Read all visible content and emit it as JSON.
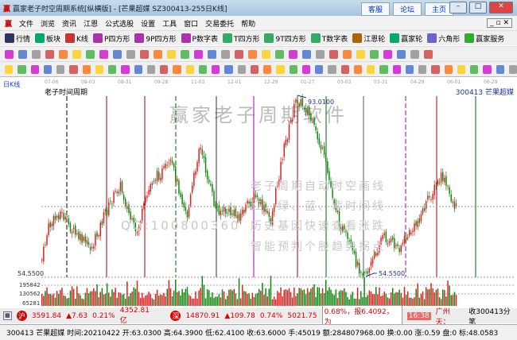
{
  "window": {
    "title": "赢家老子时空周期系统[纵横版] - [芒果超媒 SZ300413-255日K线]",
    "links": [
      "客服",
      "论坛",
      "主页"
    ]
  },
  "menu": [
    "文件",
    "浏览",
    "资讯",
    "江恩",
    "公式选股",
    "设置",
    "工具",
    "窗口",
    "交易委托",
    "帮助"
  ],
  "toolbar1": [
    "行情",
    "板块",
    "K线",
    "P四方形",
    "9P四方形",
    "P数字表",
    "T四方形",
    "9T四方形",
    "T数字表",
    "江恩轮",
    "赢家轮",
    "六角形",
    "赢家服务"
  ],
  "chart": {
    "period_label": "日K线",
    "indicator_name": "老子时间周期",
    "stock": "300413 芒果超媒",
    "date_ticks": [
      "07-06",
      "08-03",
      "08-31",
      "09-28",
      "11-03",
      "12-01",
      "12-29",
      "01-27",
      "03-03",
      "03-31",
      "04-29",
      "06-01",
      "06-29"
    ],
    "high_label": "93.0100",
    "low_label": "54.5500",
    "axis_low": "54.5500",
    "volume_ticks": [
      "195842",
      "130562",
      "65281"
    ],
    "watermark_title": "赢家老子周期软件",
    "watermark_lines": [
      "老子周期自动时空画线",
      "红、绿、蓝、紫时间线",
      "历史基因快速查看涨跌",
      "智能预判个股趋势拐点"
    ],
    "watermark_qq": "QQ:100800360",
    "colors": {
      "up": "#e02020",
      "down": "#108810",
      "high_low": "#2030a0"
    }
  },
  "status": {
    "sh_index": "3591.84",
    "sh_change": "▲7.63",
    "sh_pct": "0.21%",
    "sh_amount": "4352.81亿",
    "sz_index": "14870.91",
    "sz_change": "▲109.78",
    "sz_pct": "0.74%",
    "sz_amount": "5021.75",
    "ticker": "0.68%，报6.4092，为",
    "ticker_box": "16:38",
    "ticker_city": "广州天：",
    "ticker_right": "收300413分笔"
  },
  "info": "300413 芒果超媒 时间:20210422 开:63.0300 高:64.3900 低:62.4100 收:63.6000 手:45019 额:284807968.00 换:0.00 涨:0.59 盘:0 标:48.0583"
}
